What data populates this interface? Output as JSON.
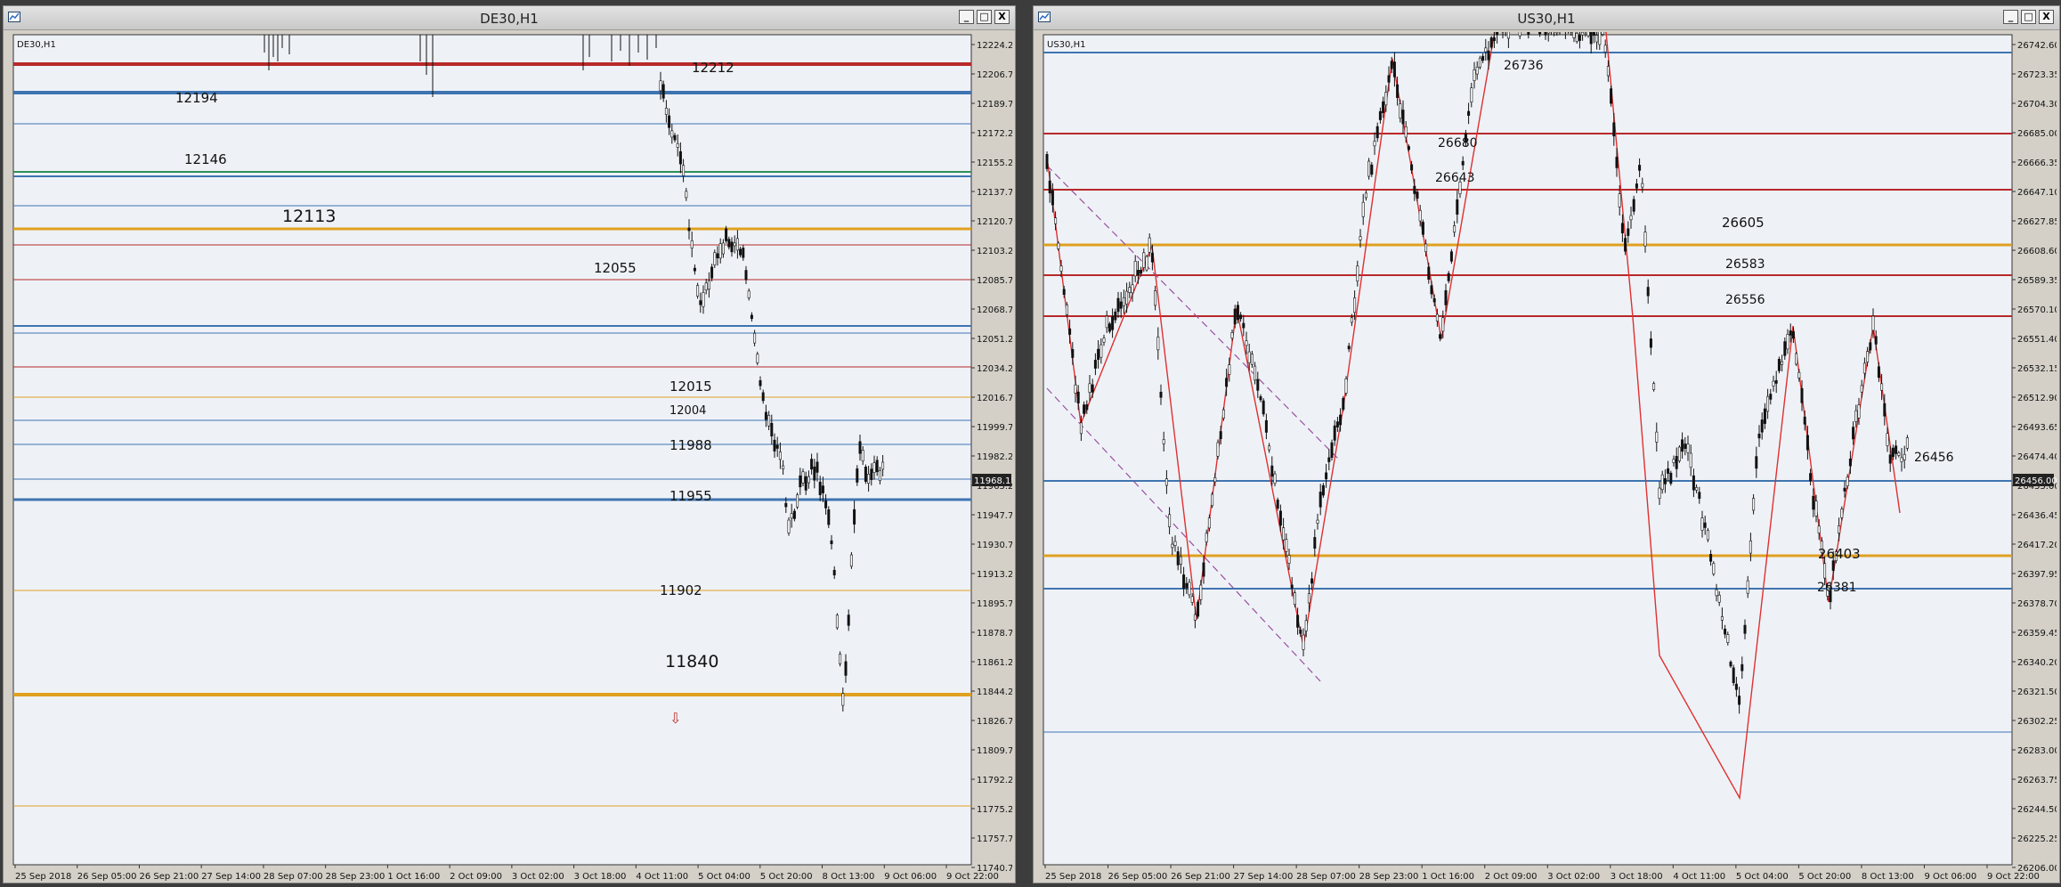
{
  "colors": {
    "bg": "#eef2f7",
    "red": "#b8282a",
    "blue": "#3f74b0",
    "orange": "#e0a020",
    "green": "#2f8f5a",
    "purple": "#9b4fa0",
    "axis": "#222"
  },
  "windows": [
    {
      "title": "DE30,H1",
      "label": "DE30,H1",
      "buttons": {
        "minimize": "_",
        "maximize": "□",
        "close": "X"
      },
      "yTicks": [
        "12224.21",
        "12206.71",
        "12189.71",
        "12172.21",
        "12155.21",
        "12137.71",
        "12120.71",
        "12103.21",
        "12085.71",
        "12068.71",
        "12051.21",
        "12034.21",
        "12016.71",
        "11999.71",
        "11982.21",
        "11965.21",
        "11947.71",
        "11930.71",
        "11913.21",
        "11895.71",
        "11878.71",
        "11861.21",
        "11844.21",
        "11826.71",
        "11809.71",
        "11792.21",
        "11775.21",
        "11757.71",
        "11740.71"
      ],
      "xTicks": [
        "25 Sep 2018",
        "26 Sep 05:00",
        "26 Sep 21:00",
        "27 Sep 14:00",
        "28 Sep 07:00",
        "28 Sep 23:00",
        "1 Oct 16:00",
        "2 Oct 09:00",
        "3 Oct 02:00",
        "3 Oct 18:00",
        "4 Oct 11:00",
        "5 Oct 04:00",
        "5 Oct 20:00",
        "8 Oct 13:00",
        "9 Oct 06:00",
        "9 Oct 22:00"
      ],
      "currentPrice": "11968.15",
      "levelLabels": [
        "12212",
        "12194",
        "12146",
        "12113",
        "12055",
        "12015",
        "12004",
        "11988",
        "11955",
        "11902",
        "11840"
      ],
      "arrowIcon": "down-arrow-icon"
    },
    {
      "title": "US30,H1",
      "label": "US30,H1",
      "buttons": {
        "minimize": "_",
        "maximize": "□",
        "close": "X"
      },
      "yTicks": [
        "26742.60",
        "26723.35",
        "26704.30",
        "26685.00",
        "26666.35",
        "26647.10",
        "26627.85",
        "26608.60",
        "26589.35",
        "26570.10",
        "26551.40",
        "26532.15",
        "26512.90",
        "26493.65",
        "26474.40",
        "26455.00",
        "26436.45",
        "26417.20",
        "26397.95",
        "26378.70",
        "26359.45",
        "26340.20",
        "26321.50",
        "26302.25",
        "26283.00",
        "26263.75",
        "26244.50",
        "26225.25",
        "26206.00"
      ],
      "xTicks": [
        "25 Sep 2018",
        "26 Sep 05:00",
        "26 Sep 21:00",
        "27 Sep 14:00",
        "28 Sep 07:00",
        "28 Sep 23:00",
        "1 Oct 16:00",
        "2 Oct 09:00",
        "3 Oct 02:00",
        "3 Oct 18:00",
        "4 Oct 11:00",
        "5 Oct 04:00",
        "5 Oct 20:00",
        "8 Oct 13:00",
        "9 Oct 06:00",
        "9 Oct 22:00"
      ],
      "currentPrice": "26456.00",
      "levelLabels": [
        "26736",
        "26680",
        "26643",
        "26605",
        "26583",
        "26556",
        "26456",
        "26403",
        "26381"
      ]
    }
  ]
}
